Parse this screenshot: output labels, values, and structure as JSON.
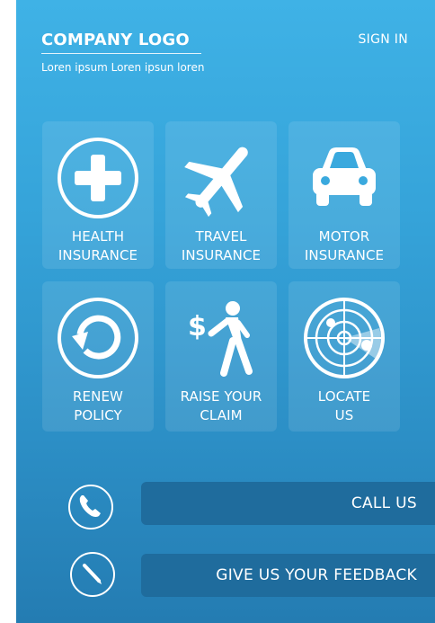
{
  "header": {
    "logo_text": "COMPANY LOGO",
    "tagline": "Loren ipsum Loren ipsun loren",
    "sign_in_label": "SIGN IN"
  },
  "tiles": [
    {
      "icon": "plus-circle-icon",
      "line1": "HEALTH",
      "line2": "INSURANCE"
    },
    {
      "icon": "airplane-icon",
      "line1": "TRAVEL",
      "line2": "INSURANCE"
    },
    {
      "icon": "car-icon",
      "line1": "MOTOR",
      "line2": "INSURANCE"
    },
    {
      "icon": "renew-arrow-icon",
      "line1": "RENEW",
      "line2": "POLICY"
    },
    {
      "icon": "person-dollar-icon",
      "line1": "RAISE YOUR",
      "line2": "CLAIM"
    },
    {
      "icon": "radar-icon",
      "line1": "LOCATE",
      "line2": "US"
    }
  ],
  "actions": {
    "call_label": "CALL US",
    "feedback_label": "GIVE US YOUR FEEDBACK",
    "call_icon": "phone-icon",
    "feedback_icon": "pencil-icon"
  },
  "colors": {
    "background_top": "#3fb2e6",
    "background_bottom": "#247cb2",
    "action_bar": "#1f6c9d"
  }
}
